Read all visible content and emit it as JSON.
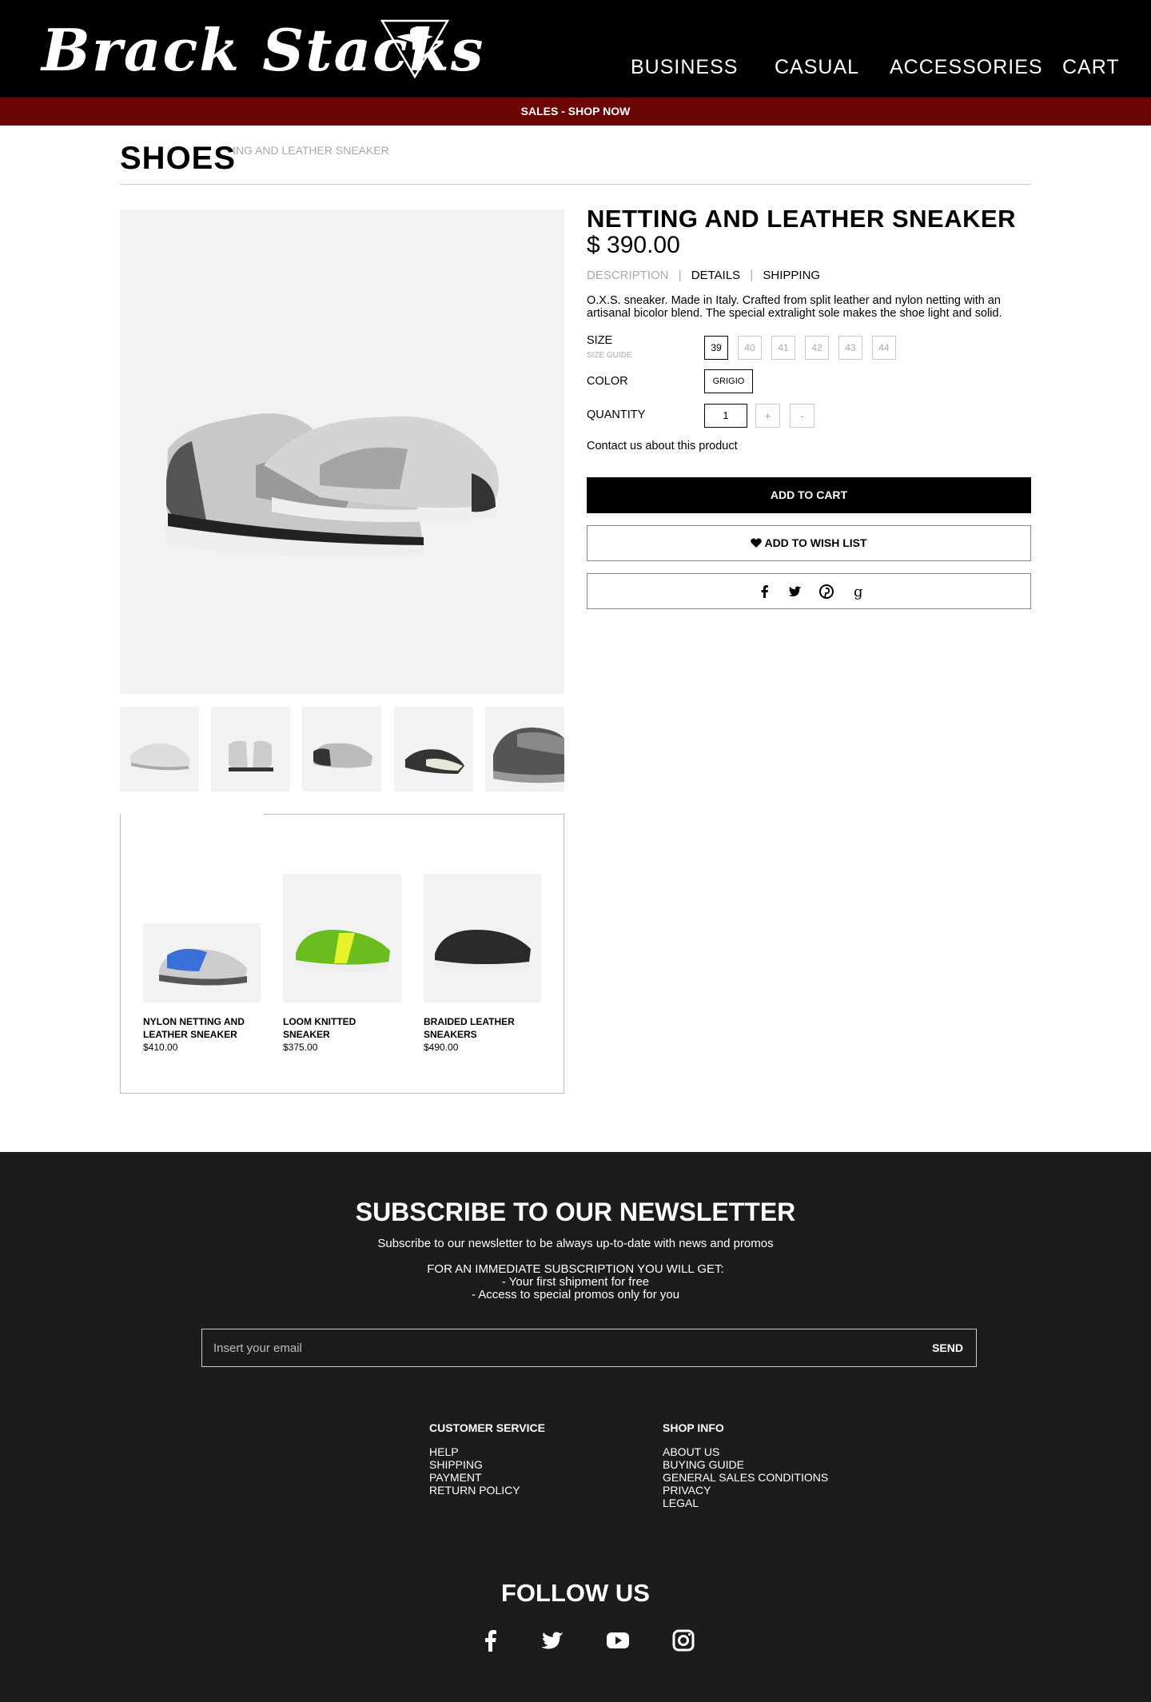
{
  "header": {
    "logo_text": "Brack Stacks",
    "nav": [
      "BUSINESS",
      "CASUAL",
      "ACCESSORIES",
      "CART"
    ]
  },
  "promo_bar": {
    "label": "SALES - SHOP NOW"
  },
  "breadcrumb": {
    "category": "SHOES",
    "product": "ING AND LEATHER SNEAKER"
  },
  "product": {
    "title": "NETTING AND LEATHER SNEAKER",
    "price": "$ 390.00",
    "tabs": [
      "DESCRIPTION",
      "DETAILS",
      "SHIPPING"
    ],
    "tab_separator": "|",
    "description": "O.X.S. sneaker. Made in Italy. Crafted from split leather and nylon netting with an artisanal bicolor blend. The special extralight sole makes the shoe light and solid.",
    "size_label": "SIZE",
    "size_guide": "SIZE GUIDE",
    "sizes": [
      "39",
      "40",
      "41",
      "42",
      "43",
      "44"
    ],
    "color_label": "COLOR",
    "color_value": "GRIGIO",
    "quantity_label": "QUANTITY",
    "quantity_value": "1",
    "qty_plus": "+",
    "qty_minus": "-",
    "contact": "Contact us about this product",
    "add_to_cart": "ADD TO CART",
    "wish_list": "ADD TO WISH LIST"
  },
  "related": [
    {
      "name": "NYLON NETTING AND LEATHER SNEAKER",
      "price": "$410.00"
    },
    {
      "name": "LOOM KNITTED SNEAKER",
      "price": "$375.00"
    },
    {
      "name": "BRAIDED LEATHER SNEAKERS",
      "price": "$490.00"
    }
  ],
  "newsletter": {
    "title": "SUBSCRIBE TO OUR NEWSLETTER",
    "subtitle": "Subscribe to our newsletter to be always up-to-date with news and promos",
    "benefits_title": "FOR AN IMMEDIATE SUBSCRIPTION YOU WILL GET:",
    "benefit_1": "- Your first shipment for free",
    "benefit_2": "- Access to special promos only for you",
    "email_placeholder": "Insert your email",
    "send": "SEND"
  },
  "footer": {
    "customer_service": {
      "title": "CUSTOMER SERVICE",
      "items": [
        "HELP",
        "SHIPPING",
        "PAYMENT",
        "RETURN POLICY"
      ]
    },
    "shop_info": {
      "title": "SHOP INFO",
      "items": [
        "ABOUT US",
        "BUYING GUIDE",
        "GENERAL SALES CONDITIONS",
        "PRIVACY",
        "LEGAL"
      ]
    },
    "follow_title": "FOLLOW US"
  }
}
